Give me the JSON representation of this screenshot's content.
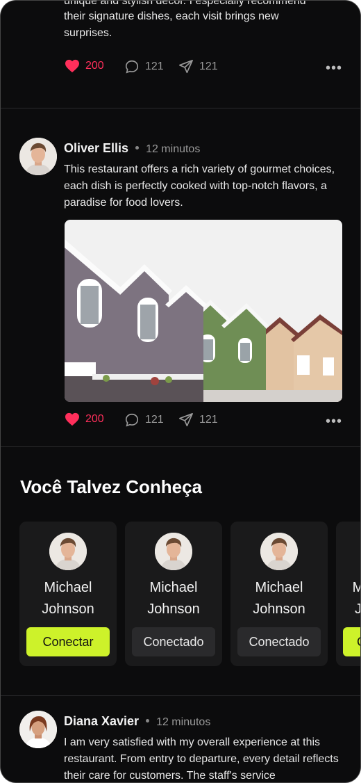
{
  "feed": {
    "post_top": {
      "text_partial": "unique and stylish decor. I especially recommend",
      "text_lines": [
        "their signature dishes, each visit brings new",
        "surprises."
      ],
      "likes": "200",
      "comments": "121",
      "shares": "121"
    },
    "post_oliver": {
      "author": "Oliver Ellis",
      "time": "12 minutos",
      "text": "This restaurant offers a rich variety of gourmet choices, each dish is perfectly cooked with top-notch flavors, a paradise for food lovers.",
      "likes": "200",
      "comments": "121",
      "shares": "121"
    },
    "suggestions": {
      "title": "Você Talvez Conheça",
      "people": [
        {
          "first": "Michael",
          "last": "Johnson",
          "button": "Conectar",
          "state": "connect"
        },
        {
          "first": "Michael",
          "last": "Johnson",
          "button": "Conectado",
          "state": "connected"
        },
        {
          "first": "Michael",
          "last": "Johnson",
          "button": "Conectado",
          "state": "connected"
        },
        {
          "first": "M",
          "last": "J",
          "button": "C",
          "state": "connect"
        }
      ]
    },
    "post_diana": {
      "author": "Diana Xavier",
      "time": "12 minutos",
      "text": "I am very satisfied with my overall experience at this restaurant. From entry to departure, every detail reflects their care for customers. The staff's service"
    }
  },
  "colors": {
    "background": "#0c0c0d",
    "like": "#ff2f5b",
    "accent_button": "#cdf22a",
    "card": "#1a1a1b"
  },
  "icons": [
    "heart-icon",
    "comment-icon",
    "share-icon",
    "more-icon"
  ]
}
